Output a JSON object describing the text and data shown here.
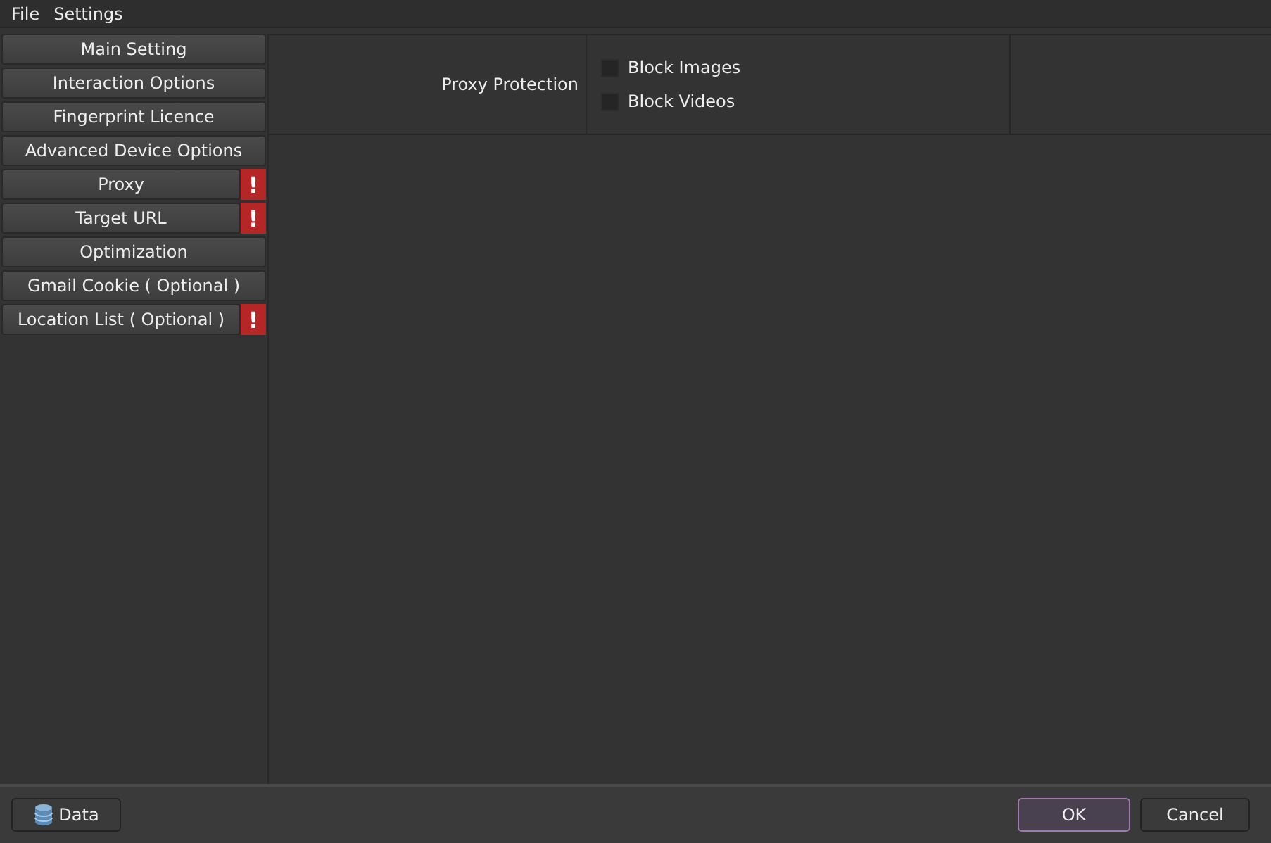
{
  "menu": [
    "File",
    "Settings"
  ],
  "sidebar": {
    "items": [
      {
        "label": "Main Setting",
        "warning": false
      },
      {
        "label": "Interaction Options",
        "warning": false
      },
      {
        "label": "Fingerprint Licence",
        "warning": false
      },
      {
        "label": "Advanced Device Options",
        "warning": false
      },
      {
        "label": "Proxy",
        "warning": true
      },
      {
        "label": "Target URL",
        "warning": true
      },
      {
        "label": "Optimization",
        "warning": false
      },
      {
        "label": "Gmail Cookie ( Optional )",
        "warning": false
      },
      {
        "label": "Location List ( Optional )",
        "warning": true
      }
    ]
  },
  "warning_mark": "!",
  "settings": {
    "label": "Proxy Protection",
    "options": [
      {
        "label": "Block Images",
        "checked": false
      },
      {
        "label": "Block Videos",
        "checked": false
      }
    ]
  },
  "footer": {
    "data_button": "Data",
    "ok": "OK",
    "cancel": "Cancel"
  }
}
